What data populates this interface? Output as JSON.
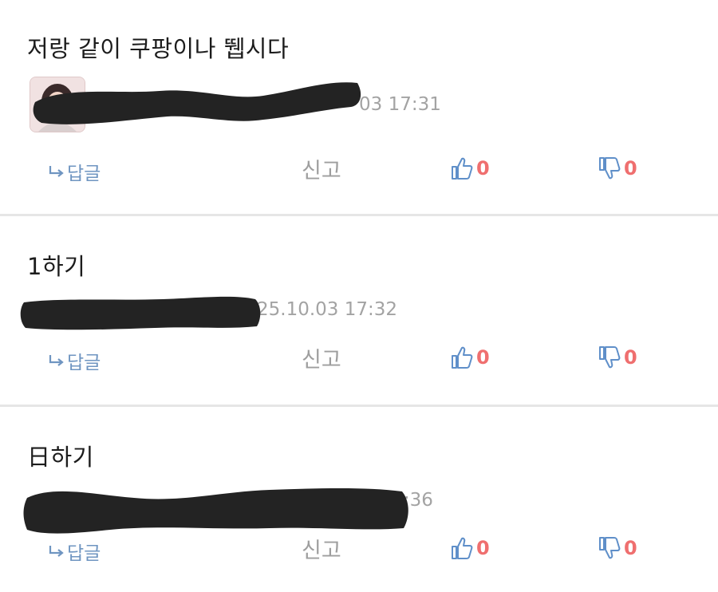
{
  "comments": [
    {
      "body": "저랑 같이 쿠팡이나 뛥시다",
      "timestamp": "03 17:31",
      "actions": {
        "reply": "답글",
        "report": "신고",
        "likes": "0",
        "dislikes": "0"
      }
    },
    {
      "body": "1하기",
      "timestamp": "25.10.03 17:32",
      "actions": {
        "reply": "답글",
        "report": "신고",
        "likes": "0",
        "dislikes": "0"
      }
    },
    {
      "body": "日하기",
      "timestamp": "03 17:36",
      "actions": {
        "reply": "답글",
        "report": "신고",
        "likes": "0",
        "dislikes": "0"
      }
    }
  ],
  "icons": {
    "reply": "reply-arrow-icon",
    "like": "thumbs-up-icon",
    "dislike": "thumbs-down-icon"
  },
  "colors": {
    "reply": "#6f95c1",
    "vote_count": "#ef6f6f",
    "icon_outline": "#5f8fc9",
    "redaction": "#232323",
    "divider": "#e6e6e6"
  }
}
